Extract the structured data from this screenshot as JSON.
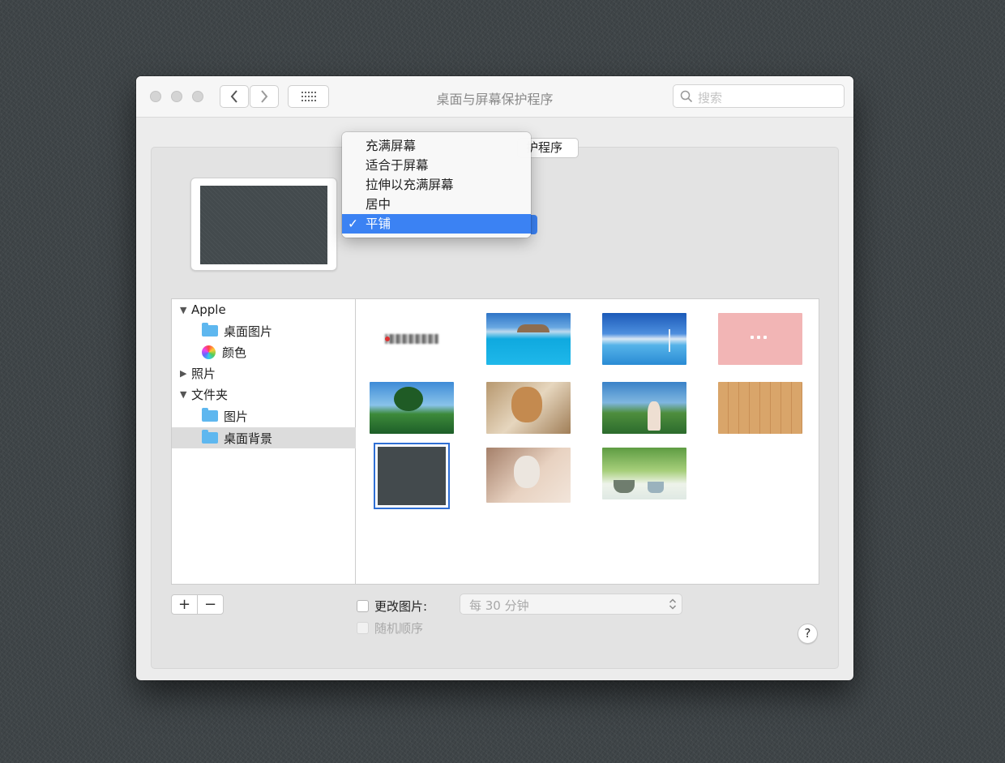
{
  "window": {
    "title": "桌面与屏幕保护程序",
    "search_placeholder": "搜索"
  },
  "tab_partial": "护程序",
  "scaling_menu": {
    "items": [
      "充满屏幕",
      "适合于屏幕",
      "拉伸以充满屏幕",
      "居中",
      "平铺"
    ],
    "selected": "平铺",
    "checkmark": "✓"
  },
  "sidebar": {
    "groups": [
      {
        "label": "Apple",
        "expanded": true,
        "children": [
          "桌面图片",
          "颜色"
        ]
      },
      {
        "label": "照片",
        "expanded": false,
        "children": []
      },
      {
        "label": "文件夹",
        "expanded": true,
        "children": [
          "图片",
          "桌面背景"
        ]
      }
    ],
    "selected": "桌面背景"
  },
  "thumbnails": [
    {
      "name": "blurred-logo",
      "selected": false
    },
    {
      "name": "beach-resort-pool",
      "selected": false
    },
    {
      "name": "blue-ocean-horizon",
      "selected": false
    },
    {
      "name": "pink-pattern",
      "selected": false
    },
    {
      "name": "green-tree-landscape",
      "selected": false
    },
    {
      "name": "cat-in-hoodie",
      "selected": false
    },
    {
      "name": "anime-forest-girl",
      "selected": false
    },
    {
      "name": "wood-planks",
      "selected": false
    },
    {
      "name": "dark-gray-texture",
      "selected": true
    },
    {
      "name": "kitten-looking-up",
      "selected": false
    },
    {
      "name": "green-plants-pots",
      "selected": false
    }
  ],
  "controls": {
    "add_symbol": "+",
    "remove_symbol": "−",
    "change_picture_label": "更改图片:",
    "interval_value": "每 30 分钟",
    "random_order_label": "随机顺序",
    "help_symbol": "?"
  },
  "colors": {
    "selection_blue": "#3b82f3",
    "folder_blue": "#5eb7ef",
    "wallpaper_gray": "#434a4d"
  }
}
